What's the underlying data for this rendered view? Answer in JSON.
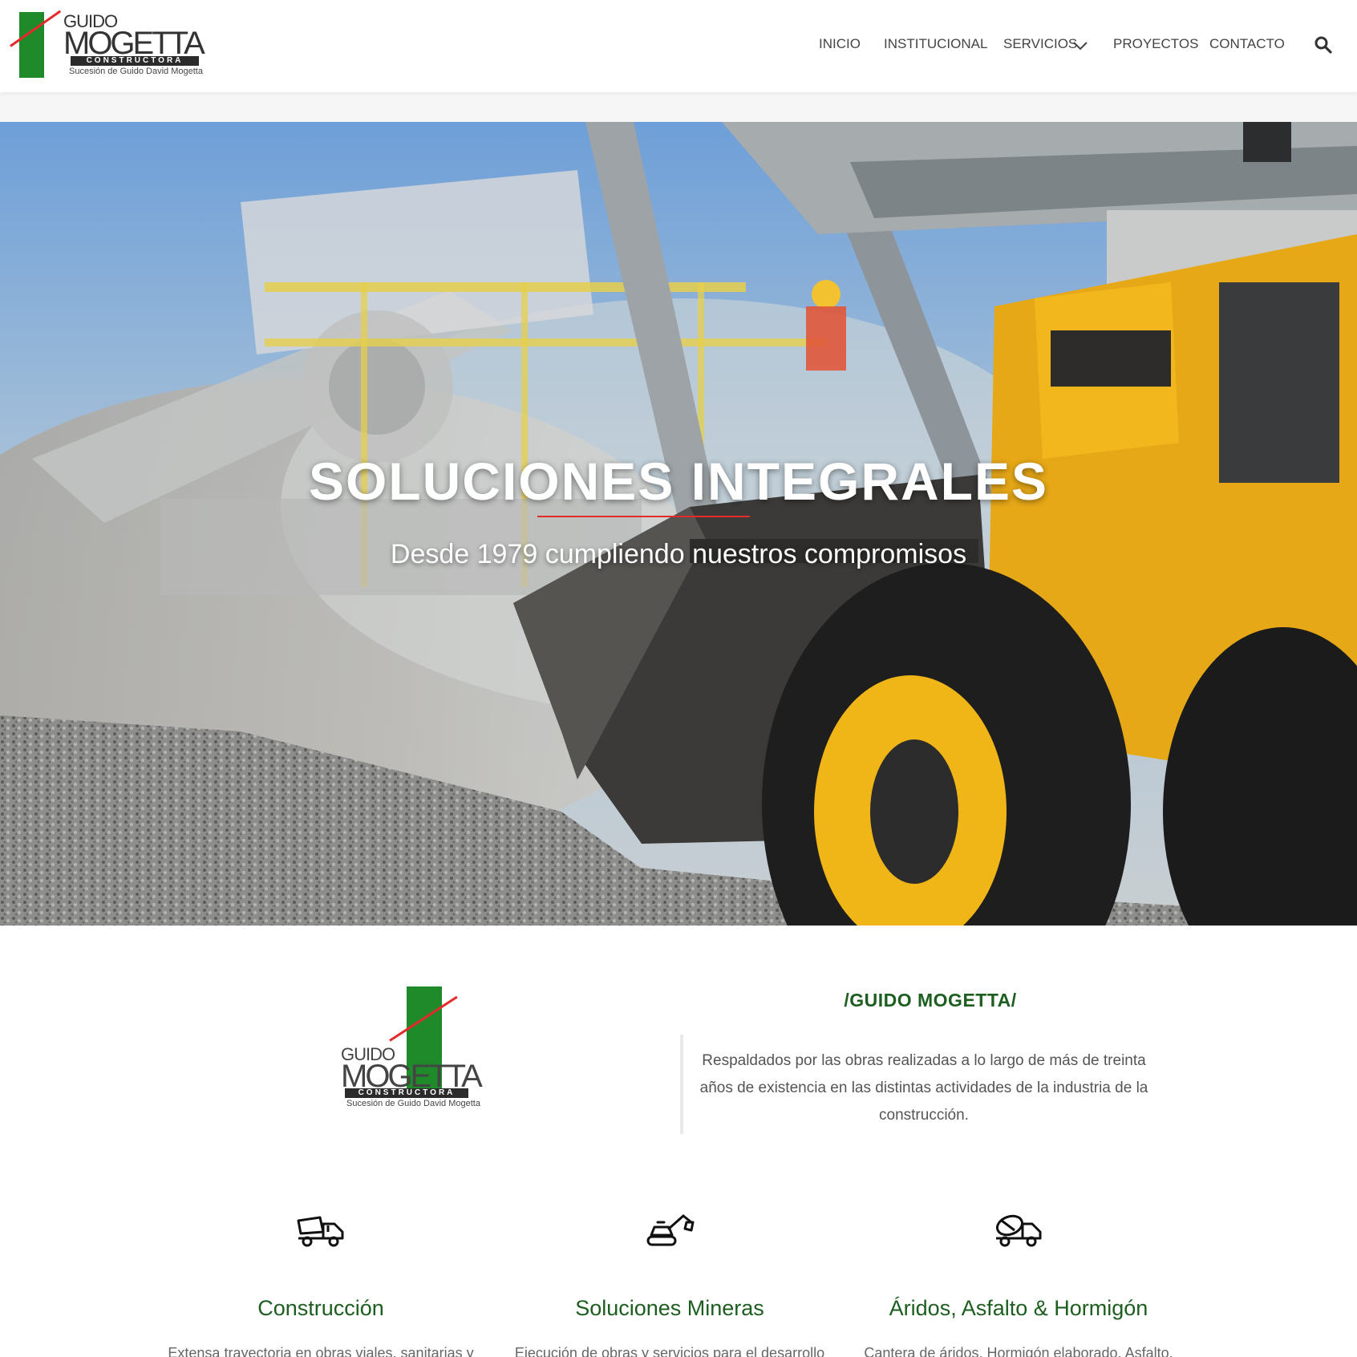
{
  "brand": {
    "logo_word1": "GUIDO",
    "logo_word2": "MOGETTA",
    "logo_band": "CONSTRUCTORA",
    "logo_tagline": "Sucesión de Guido David Mogetta",
    "colors": {
      "green": "#1f8a2a",
      "red": "#e32b2b",
      "dark_green_text": "#1c5e1f"
    }
  },
  "nav": {
    "items": [
      {
        "label": "INICIO"
      },
      {
        "label": "INSTITUCIONAL"
      },
      {
        "label": "SERVICIOS"
      },
      {
        "label": "PROYECTOS"
      },
      {
        "label": "CONTACTO"
      }
    ],
    "search_icon": "search-icon"
  },
  "hero": {
    "title": "SOLUCIONES INTEGRALES",
    "subtitle": "Desde 1979 cumpliendo nuestros compromisos",
    "image": "yellow wheel loader and crusher conveyor over gravel"
  },
  "about": {
    "heading": "/GUIDO MOGETTA/",
    "text": "Respaldados por las obras realizadas a lo largo de más de treinta años de existencia en las distintas actividades de la industria de la construcción."
  },
  "services": [
    {
      "icon": "dump-truck-icon",
      "title": "Construcción",
      "desc": "Extensa trayectoria en obras viales, sanitarias y"
    },
    {
      "icon": "excavator-icon",
      "title": "Soluciones Mineras",
      "desc": "Ejecución de obras y servicios para el desarrollo"
    },
    {
      "icon": "concrete-mixer-icon",
      "title": "Áridos, Asfalto & Hormigón",
      "desc": "Cantera de áridos. Hormigón elaborado. Asfalto."
    }
  ]
}
